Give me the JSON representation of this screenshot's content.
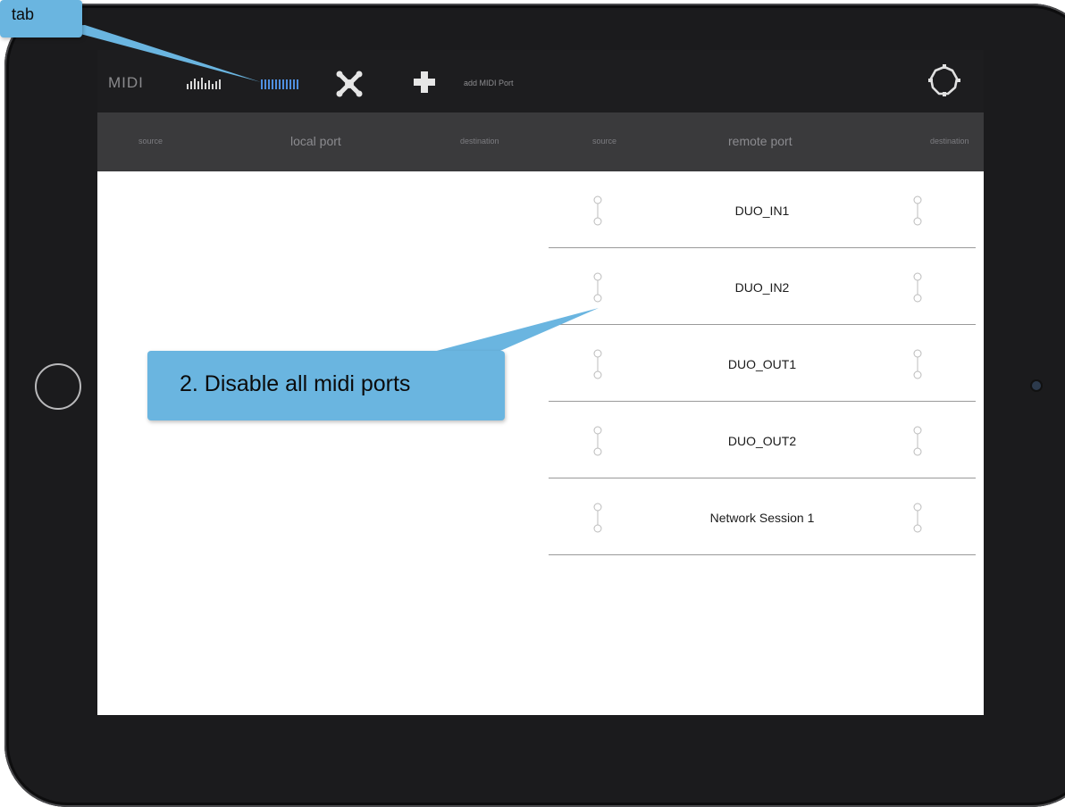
{
  "app": {
    "title": "MIDI",
    "add_port_label": "add MIDI Port"
  },
  "icons": {
    "meter_tab": "meter-tab-icon",
    "ports_tab": "ports-tab-icon",
    "connect": "network-connect-icon",
    "add": "plus-icon",
    "settings": "gear-icon"
  },
  "colors": {
    "active_tab": "#4f8fe0",
    "topbar": "#1d1d1f",
    "header": "#3a3a3c",
    "callout": "#6ab5e0"
  },
  "columns": {
    "local_source": "source",
    "local_port": "local port",
    "local_destination": "destination",
    "remote_source": "source",
    "remote_port": "remote port",
    "remote_destination": "destination"
  },
  "remote_ports": [
    {
      "name": "DUO_IN1"
    },
    {
      "name": "DUO_IN2"
    },
    {
      "name": "DUO_OUT1"
    },
    {
      "name": "DUO_OUT2"
    },
    {
      "name": "Network Session 1"
    }
  ],
  "callouts": {
    "tab": "tab",
    "disable": "2. Disable all midi ports"
  }
}
